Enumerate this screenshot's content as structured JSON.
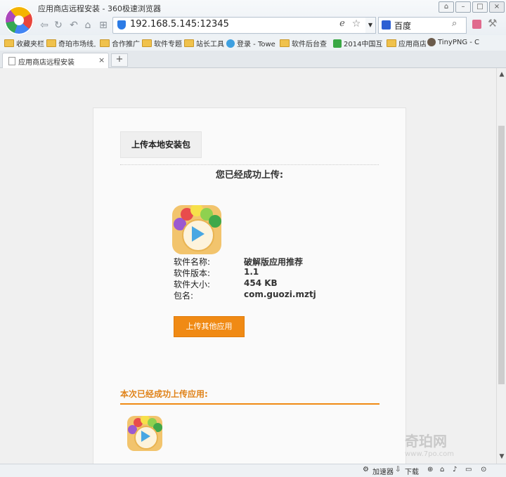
{
  "window": {
    "title": "应用商店远程安装 - 360极速浏览器"
  },
  "toolbar": {
    "url": "192.168.5.145:12345",
    "search_engine": "百度"
  },
  "bookmarks": [
    {
      "label": "收藏夹栏",
      "type": "folder"
    },
    {
      "label": "奇珀市场线上",
      "type": "folder"
    },
    {
      "label": "合作推广",
      "type": "folder"
    },
    {
      "label": "软件专题",
      "type": "folder"
    },
    {
      "label": "站长工具",
      "type": "folder"
    },
    {
      "label": "登录 - Towe",
      "type": "site",
      "color": "#3ea0e0"
    },
    {
      "label": "软件后台查",
      "type": "folder"
    },
    {
      "label": "2014中国互",
      "type": "site",
      "color": "#3aa845"
    },
    {
      "label": "应用商店",
      "type": "folder"
    },
    {
      "label": "TinyPNG - C",
      "type": "site",
      "color": "#6b5b4b"
    }
  ],
  "tab": {
    "title": "应用商店远程安装",
    "new_tab": "+",
    "close": "×"
  },
  "page": {
    "upload_local_label": "上传本地安装包",
    "success_heading": "您已经成功上传:",
    "app": {
      "name_label": "软件名称:",
      "name": "破解版应用推荐",
      "version_label": "软件版本:",
      "version": "1.1",
      "size_label": "软件大小:",
      "size": "454 KB",
      "package_label": "包名:",
      "package": "com.guozi.mztj"
    },
    "upload_other_label": "上传其他应用",
    "session_title": "本次已经成功上传应用:"
  },
  "statusbar": {
    "accelerator": "加速器",
    "download": "下载"
  },
  "watermark": {
    "brand": "奇珀网",
    "site": "www.7po.com"
  },
  "colors": {
    "accent": "#f08a14",
    "section_title": "#e0831a"
  }
}
